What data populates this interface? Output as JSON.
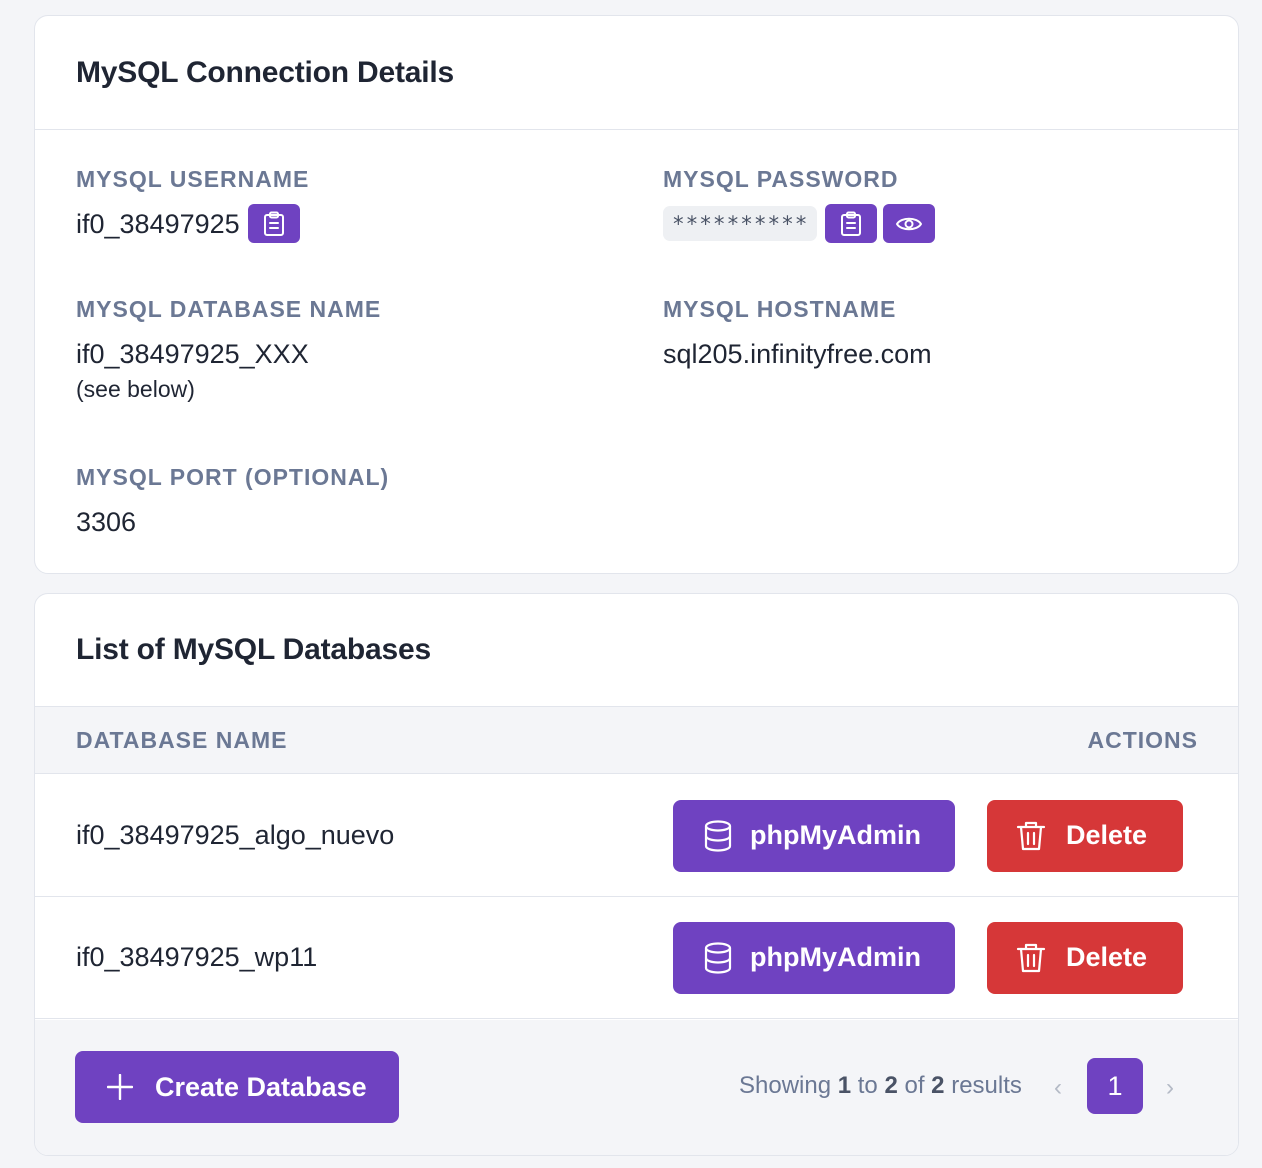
{
  "connection": {
    "title": "MySQL Connection Details",
    "username_label": "MYSQL USERNAME",
    "username_value": "if0_38497925",
    "password_label": "MYSQL PASSWORD",
    "password_masked": "**********",
    "dbname_label": "MYSQL DATABASE NAME",
    "dbname_value": "if0_38497925_XXX",
    "dbname_note": "(see below)",
    "hostname_label": "MYSQL HOSTNAME",
    "hostname_value": "sql205.infinityfree.com",
    "port_label": "MYSQL PORT (OPTIONAL)",
    "port_value": "3306"
  },
  "databases": {
    "title": "List of MySQL Databases",
    "col_name": "DATABASE NAME",
    "col_actions": "ACTIONS",
    "rows": [
      {
        "name": "if0_38497925_algo_nuevo",
        "phpmyadmin": "phpMyAdmin",
        "delete": "Delete"
      },
      {
        "name": "if0_38497925_wp11",
        "phpmyadmin": "phpMyAdmin",
        "delete": "Delete"
      }
    ],
    "create_label": "Create Database",
    "pagination": {
      "showing": "Showing",
      "from": "1",
      "to_word": "to",
      "to": "2",
      "of_word": "of",
      "total": "2",
      "results_word": "results",
      "current_page": "1",
      "prev": "‹",
      "next": "›"
    }
  },
  "colors": {
    "accent": "#6f42c1",
    "danger": "#d63738",
    "label": "#6b7894"
  },
  "icons": [
    "clipboard-icon",
    "eye-icon",
    "database-icon",
    "trash-icon",
    "plus-icon"
  ]
}
